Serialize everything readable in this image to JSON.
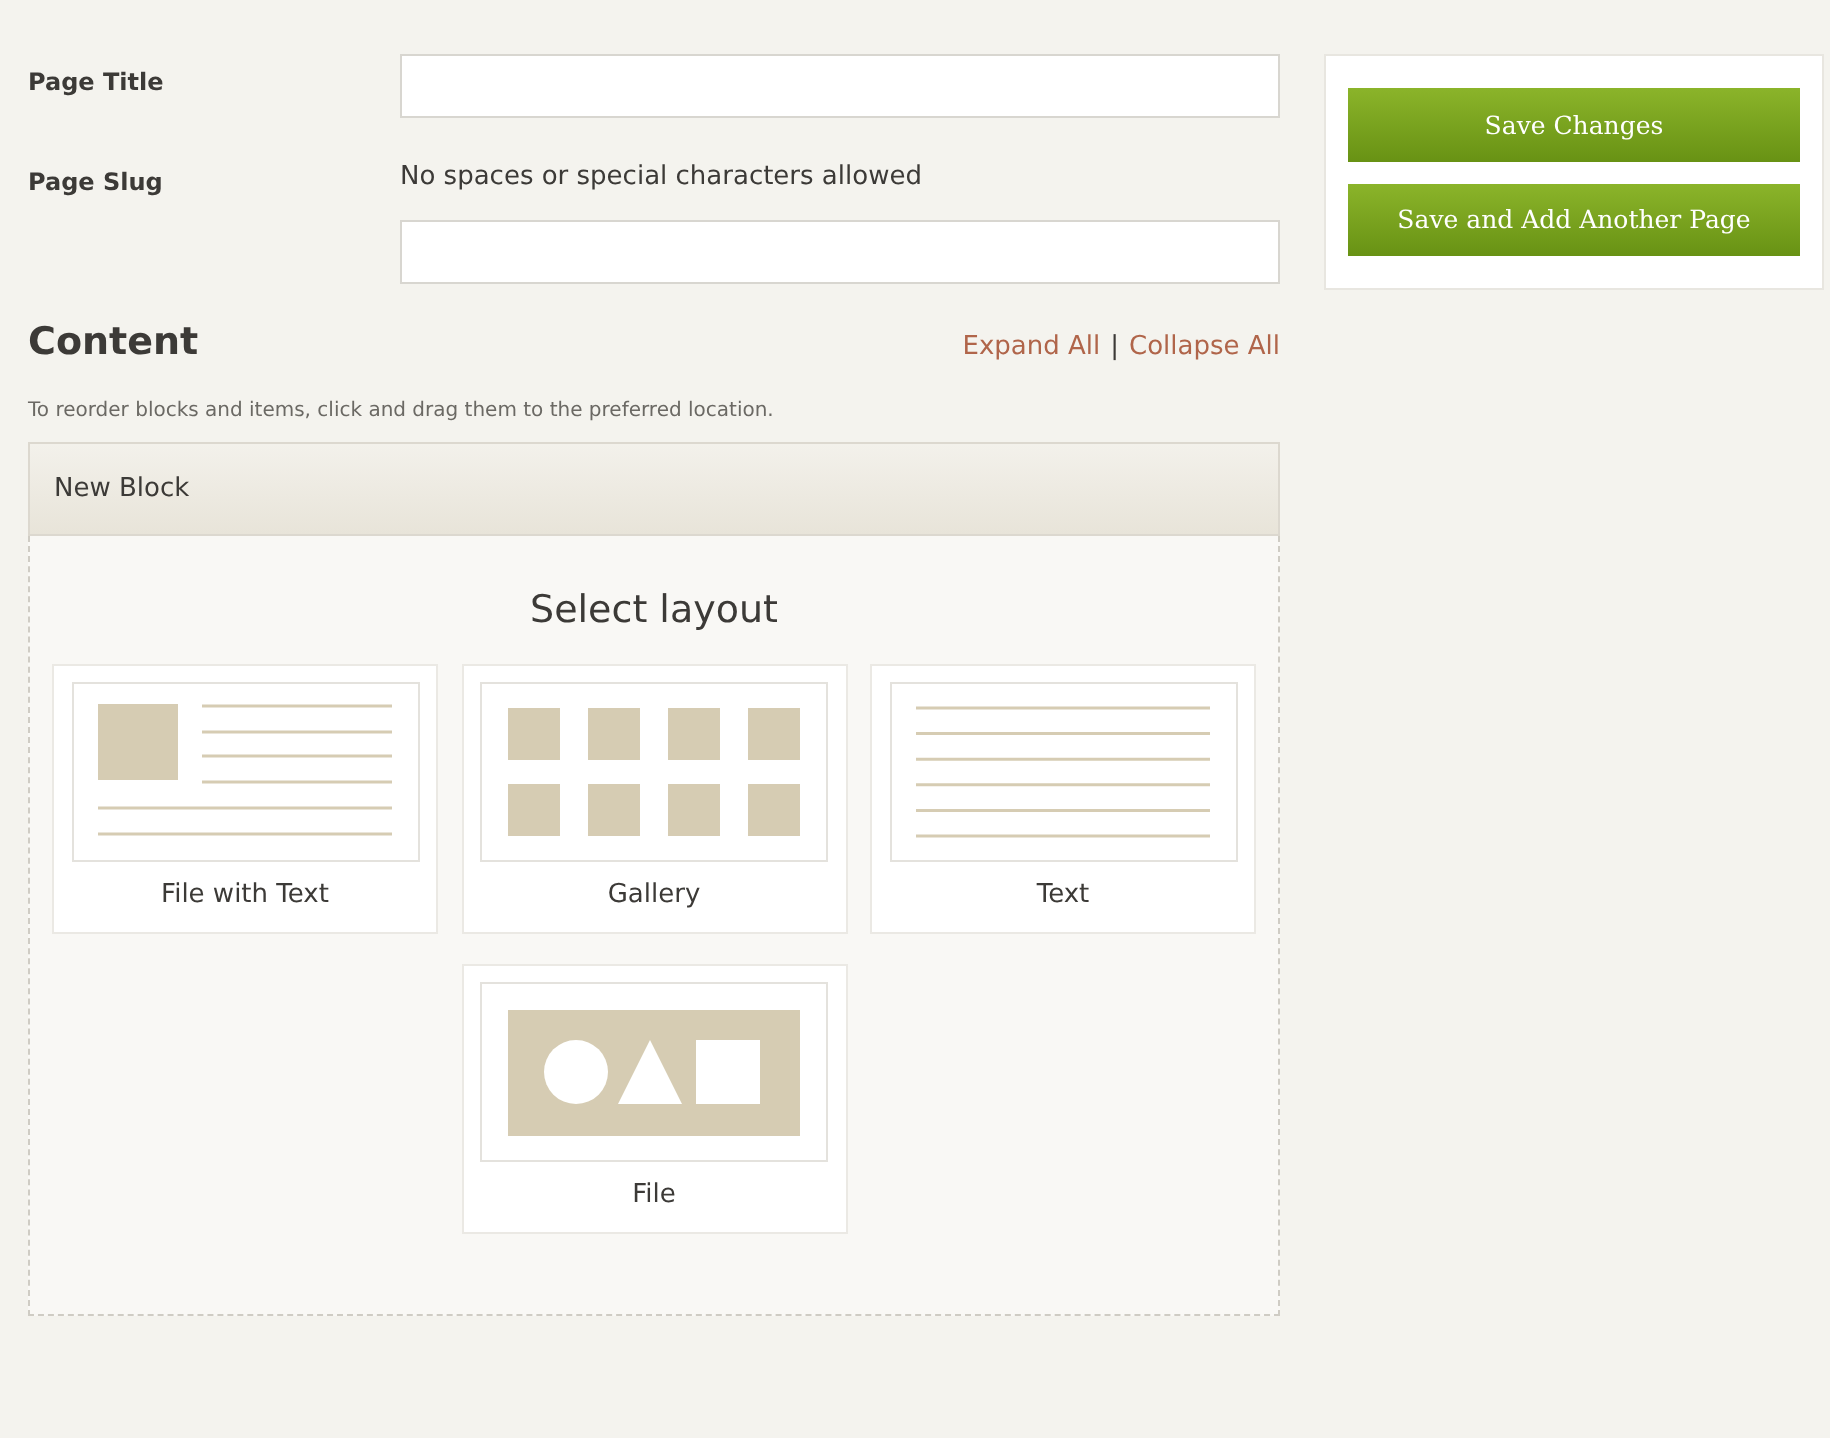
{
  "form": {
    "fields": [
      {
        "label": "Page Title"
      },
      {
        "label": "Page Slug",
        "hint": "No spaces or special characters allowed"
      }
    ]
  },
  "content": {
    "heading": "Content",
    "expand": "Expand All",
    "separator": "|",
    "collapse": "Collapse All",
    "instructions": "To reorder blocks and items, click and drag them to the preferred location.",
    "block": {
      "title": "New Block",
      "layout_heading": "Select layout",
      "layouts": [
        {
          "kind": "file_text",
          "label": "File with Text"
        },
        {
          "kind": "gallery",
          "label": "Gallery"
        },
        {
          "kind": "text",
          "label": "Text"
        },
        {
          "kind": "file",
          "label": "File"
        }
      ]
    }
  },
  "actions": [
    "Save Changes",
    "Save and Add Another Page"
  ]
}
